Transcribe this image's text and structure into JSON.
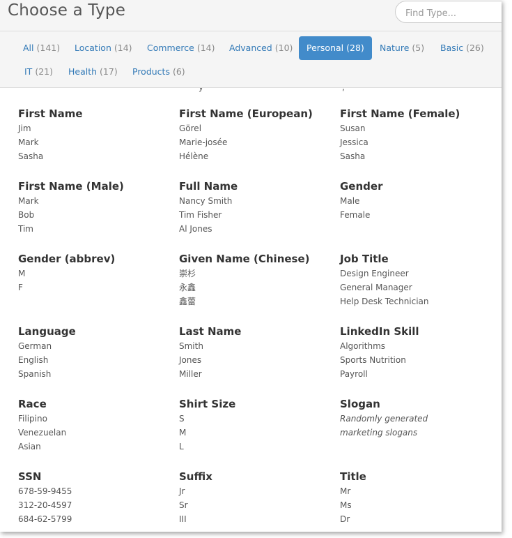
{
  "header": {
    "title": "Choose a Type",
    "search_placeholder": "Find Type..."
  },
  "tabs": [
    {
      "label": "All",
      "count": "(141)",
      "active": false
    },
    {
      "label": "Location",
      "count": "(14)",
      "active": false
    },
    {
      "label": "Commerce",
      "count": "(14)",
      "active": false
    },
    {
      "label": "Advanced",
      "count": "(10)",
      "active": false
    },
    {
      "label": "Personal",
      "count": "(28)",
      "active": true
    },
    {
      "label": "Nature",
      "count": "(5)",
      "active": false
    },
    {
      "label": "Basic",
      "count": "(26)",
      "active": false
    },
    {
      "label": "IT",
      "count": "(21)",
      "active": false
    },
    {
      "label": "Health",
      "count": "(17)",
      "active": false
    },
    {
      "label": "Products",
      "count": "(6)",
      "active": false
    }
  ],
  "types": [
    {
      "name": "First Name",
      "examples": [
        "Jim",
        "Mark",
        "Sasha"
      ]
    },
    {
      "name": "First Name (European)",
      "examples": [
        "Görel",
        "Marie-josée",
        "Hélène"
      ]
    },
    {
      "name": "First Name (Female)",
      "examples": [
        "Susan",
        "Jessica",
        "Sasha"
      ]
    },
    {
      "name": "First Name (Male)",
      "examples": [
        "Mark",
        "Bob",
        "Tim"
      ]
    },
    {
      "name": "Full Name",
      "examples": [
        "Nancy Smith",
        "Tim Fisher",
        "Al Jones"
      ]
    },
    {
      "name": "Gender",
      "examples": [
        "Male",
        "Female"
      ]
    },
    {
      "name": "Gender (abbrev)",
      "examples": [
        "M",
        "F"
      ]
    },
    {
      "name": "Given Name (Chinese)",
      "examples": [
        "崇杉",
        "永鑫",
        "鑫蕾"
      ]
    },
    {
      "name": "Job Title",
      "examples": [
        "Design Engineer",
        "General Manager",
        "Help Desk Technician"
      ]
    },
    {
      "name": "Language",
      "examples": [
        "German",
        "English",
        "Spanish"
      ]
    },
    {
      "name": "Last Name",
      "examples": [
        "Smith",
        "Jones",
        "Miller"
      ]
    },
    {
      "name": "LinkedIn Skill",
      "examples": [
        "Algorithms",
        "Sports Nutrition",
        "Payroll"
      ]
    },
    {
      "name": "Race",
      "examples": [
        "Filipino",
        "Venezuelan",
        "Asian"
      ]
    },
    {
      "name": "Shirt Size",
      "examples": [
        "S",
        "M",
        "L"
      ]
    },
    {
      "name": "Slogan",
      "description": "Randomly generated marketing slogans"
    },
    {
      "name": "SSN",
      "examples": [
        "678-59-9455",
        "312-20-4597",
        "684-62-5799"
      ]
    },
    {
      "name": "Suffix",
      "examples": [
        "Jr",
        "Sr",
        "III"
      ]
    },
    {
      "name": "Title",
      "examples": [
        "Mr",
        "Ms",
        "Dr"
      ]
    }
  ]
}
